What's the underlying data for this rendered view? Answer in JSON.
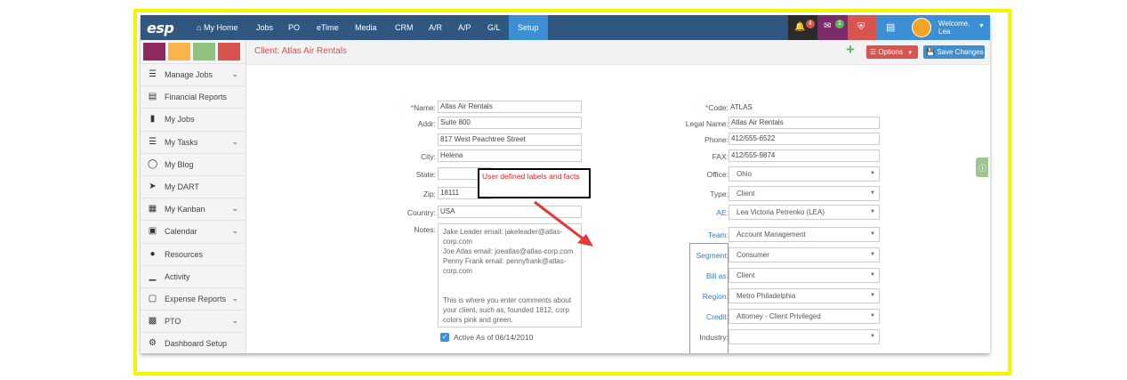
{
  "nav": {
    "logo": "esp",
    "items": [
      {
        "label": "My Home",
        "icon": "home-icon"
      },
      {
        "label": "Jobs"
      },
      {
        "label": "PO"
      },
      {
        "label": "eTime"
      },
      {
        "label": "Media"
      },
      {
        "label": "CRM"
      },
      {
        "label": "A/R"
      },
      {
        "label": "A/P"
      },
      {
        "label": "G/L"
      },
      {
        "label": "Setup",
        "active": true
      }
    ],
    "alerts_count": "4",
    "messages_count": "1",
    "welcome_label": "Welcome,",
    "user_name": "Lea"
  },
  "colors": {
    "swatch1": "#8e2a5f",
    "swatch2": "#f9b54b",
    "swatch3": "#8fc37c",
    "swatch4": "#d9534f",
    "nav": "#2f5780",
    "accent": "#3d8fd3"
  },
  "sidebar": {
    "items": [
      {
        "label": "Manage Jobs",
        "icon": "sitemap-icon",
        "chevron": true
      },
      {
        "label": "Financial Reports",
        "icon": "report-icon",
        "chevron": false
      },
      {
        "label": "My Jobs",
        "icon": "folder-icon",
        "chevron": false
      },
      {
        "label": "My Tasks",
        "icon": "tasks-icon",
        "chevron": true
      },
      {
        "label": "My Blog",
        "icon": "chat-icon",
        "chevron": false
      },
      {
        "label": "My DART",
        "icon": "arrow-circle-icon",
        "chevron": false
      },
      {
        "label": "My Kanban",
        "icon": "map-icon",
        "chevron": true
      },
      {
        "label": "Calendar",
        "icon": "calendar-icon",
        "chevron": true
      },
      {
        "label": "Resources",
        "icon": "users-icon",
        "chevron": false
      },
      {
        "label": "Activity",
        "icon": "signal-icon",
        "chevron": false
      },
      {
        "label": "Expense Reports",
        "icon": "money-icon",
        "chevron": true
      },
      {
        "label": "PTO",
        "icon": "calendar-grid-icon",
        "chevron": true
      },
      {
        "label": "Dashboard Setup",
        "icon": "gears-icon",
        "chevron": false
      }
    ]
  },
  "header": {
    "title": "Client: Atlas Air Rentals",
    "options_label": "Options",
    "save_label": "Save Changes"
  },
  "form": {
    "name_label": "Name:",
    "name": "Atlas Air Rentals",
    "addr_label": "Addr:",
    "addr1": "Suite 800",
    "addr2": "817 West Peachtree Street",
    "city_label": "City:",
    "city": "Helena",
    "state_label": "State:",
    "state": "",
    "zip_label": "Zip:",
    "zip": "18111",
    "country_label": "Country:",
    "country": "USA",
    "notes_label": "Notes:",
    "notes": "Jake Leader email: jakeleader@atlas-corp.com\nJoe Atlas email: joeatlas@atlas-corp.com\nPenny Frank email: pennyfrank@atlas-corp.com\n\n\nThis is where you enter comments about your client, such as, founded 1812, corp colors pink and green.",
    "active_label": "Active As of 06/14/2010",
    "code_label": "Code:",
    "code": "ATLAS",
    "legal_label": "Legal Name:",
    "legal": "Atlas Air Rentals",
    "phone_label": "Phone:",
    "phone": "412/555-6522",
    "fax_label": "FAX:",
    "fax": "412/555-9874",
    "office_label": "Office:",
    "office": "Ohio",
    "type_label": "Type:",
    "type": "Client",
    "ae_label": "AE:",
    "ae": "Lea Victoria Petrenko (LEA)",
    "team_label": "Team:",
    "team": "Account Management",
    "segment_label": "Segment:",
    "segment": "Consumer",
    "billas_label": "Bill as:",
    "billas": "Client",
    "region_label": "Region:",
    "region": "Metro Philadelphia",
    "credit_label": "Credit:",
    "credit": "Attorney - Client Privileged",
    "industry_label": "Industry:",
    "industry": ""
  },
  "callout": "User defined labels and facts"
}
